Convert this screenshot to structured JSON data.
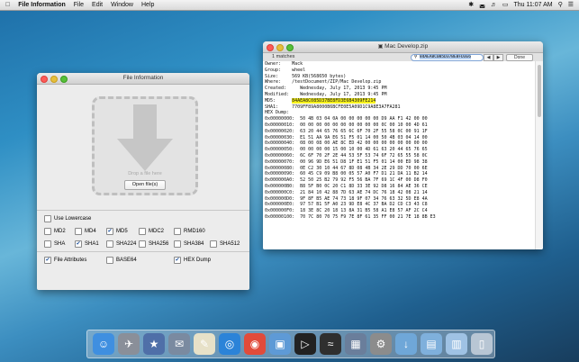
{
  "menubar": {
    "apple_icon": "apple-icon",
    "app_name": "File Information",
    "menus": [
      "File",
      "Edit",
      "Window",
      "Help"
    ],
    "clock": "Thu 11:07 AM"
  },
  "file_info_window": {
    "title": "File Information",
    "drop_text": "Drop a file here",
    "open_button": "Open file(s)",
    "options": {
      "use_lowercase": {
        "label": "Use Lowercase",
        "checked": false
      },
      "row1": [
        {
          "label": "MD2",
          "checked": false
        },
        {
          "label": "MD4",
          "checked": false
        },
        {
          "label": "MD5",
          "checked": true
        },
        {
          "label": "MDC2",
          "checked": false
        },
        {
          "label": "RMD160",
          "checked": false
        }
      ],
      "row2": [
        {
          "label": "SHA",
          "checked": false
        },
        {
          "label": "SHA1",
          "checked": true
        },
        {
          "label": "SHA224",
          "checked": false
        },
        {
          "label": "SHA256",
          "checked": false
        },
        {
          "label": "SHA384",
          "checked": false
        },
        {
          "label": "SHA512",
          "checked": false
        }
      ],
      "row3": [
        {
          "label": "File Attributes",
          "checked": true
        },
        {
          "label": "BASE64",
          "checked": false
        },
        {
          "label": "HEX Dump",
          "checked": true
        }
      ]
    }
  },
  "doc_window": {
    "title": "Mac Develop.zip",
    "matches": "1 matches",
    "search_value": "84AEA8C085D37BE8FD3E6",
    "done": "Done",
    "lines": [
      "Owner:    Mack",
      "Group:    wheel",
      "Size:     569 KB(568650 bytes)",
      "Where:    /testDocument/ZIP/Mac Develop.zip",
      "Created:     Wednesday, July 17, 2013 9:45 PM",
      "Modified:    Wednesday, July 17, 2013 9:45 PM",
      "",
      "MD5:",
      "",
      "SHA1:     7709FF89A8000B6BCFE0E5A09D1C9A8E3A7FA281",
      "",
      "",
      "HEX Dump:",
      "0x00000000:  50 4B 03 04 0A 00 00 00 00 00 D9 AA F1 42 00 00",
      "0x00000010:  00 00 00 00 00 00 00 00 00 00 0C 00 10 00 4D 61",
      "0x00000020:  63 20 44 65 76 65 6C 6F 70 2F 55 58 0C 00 91 1F",
      "0x00000030:  E1 51 AA 9A E6 51 F5 01 14 00 50 4B 03 04 14 00",
      "0x00000040:  08 00 08 00 AE 8C ED 42 00 00 00 00 00 00 00 00",
      "0x00000050:  00 00 00 00 15 00 10 00 4D 61 63 20 44 65 76 65",
      "0x00000060:  6C 6F 70 2F 2E 44 53 5F 53 74 6F 72 65 55 58 0C",
      "0x00000070:  00 96 9D E6 51 D8 1F E1 51 F5 01 14 00 ED 98 38",
      "0x00000080:  0E C2 30 10 44 67 8D 08 4B 34 2E 29 DD 70 00 6E",
      "0x00000090:  60 45 C9 09 B8 00 05 57 A0 F7 D1 21 DA 11 B2 14",
      "0x000000A0:  52 50 25 B2 79 92 F5 56 BA 7F 69 1C 4F 00 D8 F0",
      "0x000000B0:  B8 5F B0 0C 20 C1 8D 33 3E 92 D8 16 84 AE 36 CE",
      "0x000000C0:  21 84 10 42 88 7D 63 AE 74 DC 76 18 42 08 21 14",
      "0x000000D0:  9F 8F B5 AE 74 73 18 9F 07 34 76 63 32 5D E8 4A",
      "0x000000E0:  97 57 B1 5F A0 23 9D E8 4C 37 BA D2 CD C3 43 C8",
      "0x000000F0:  18 3E 8C 20 18 13 8A 31 B5 58 A1 E8 57 AF 2C C4",
      "0x00000100:  70 7C 80 70 75 F9 7E 8F 61 35 FF 00 21 7E 18 8B E3"
    ],
    "md5_value": "84AEA8C085D37BE8FD3E6B4309FE214"
  },
  "dock": {
    "icons": [
      "finder-icon",
      "launchpad-icon",
      "app-store-icon",
      "mail-icon",
      "textedit-icon",
      "safari-icon",
      "chrome-icon",
      "preview-icon",
      "terminal-icon",
      "activity-monitor-icon",
      "image-capture-icon",
      "system-preferences-icon",
      "downloads-icon",
      "folder-icon",
      "documents-icon",
      "trash-icon"
    ]
  },
  "colors": {
    "highlight_yellow": "#f6f11d",
    "search_blue": "#b7d1f2",
    "check_blue": "#1b4f9c"
  }
}
